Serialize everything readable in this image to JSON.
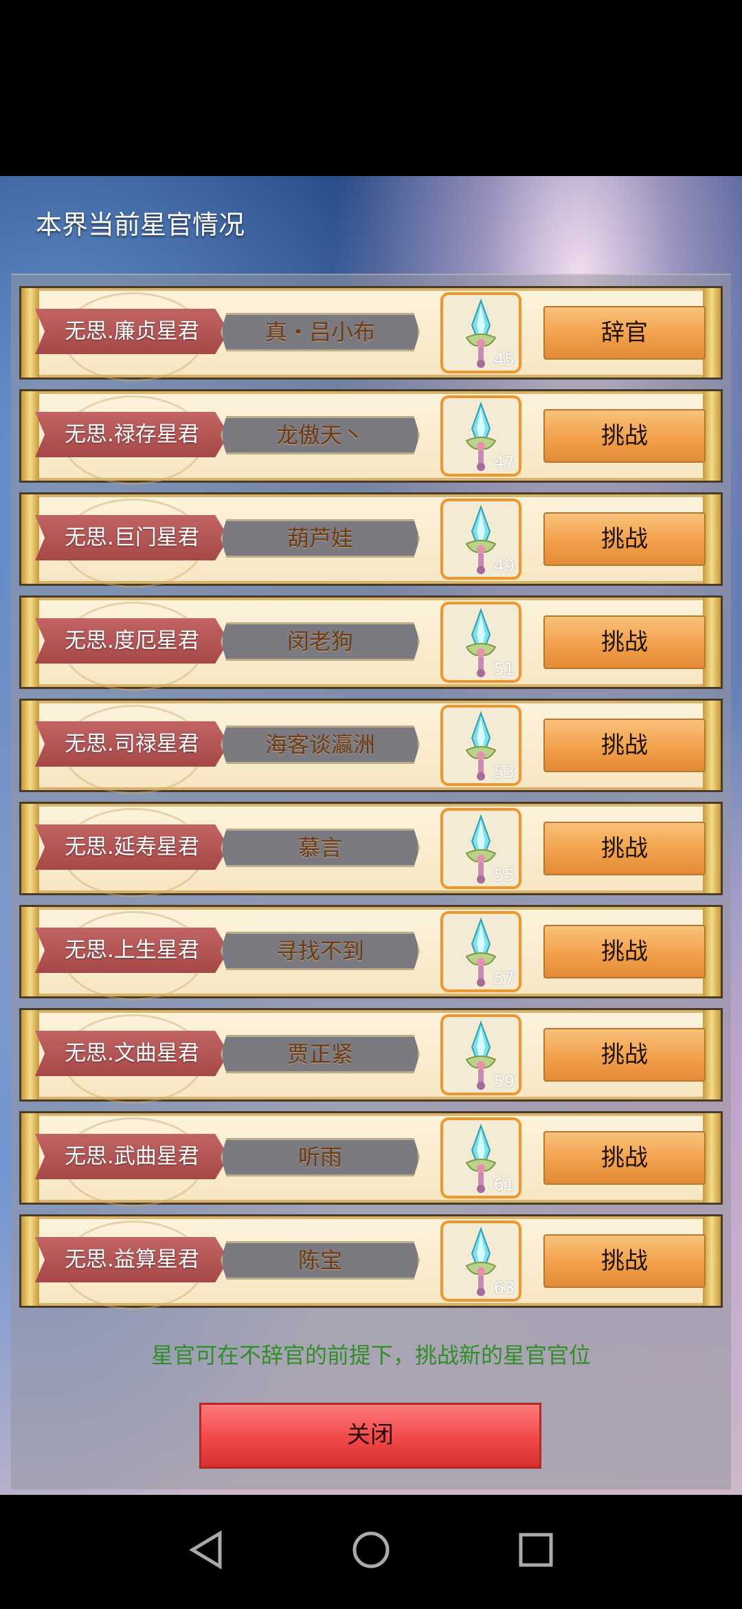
{
  "panel": {
    "title": "本界当前星官情况",
    "rows": [
      {
        "title": "无思.廉贞星君",
        "holder": "真・吕小布",
        "level": "45",
        "action": "辞官"
      },
      {
        "title": "无思.禄存星君",
        "holder": "龙傲天丶",
        "level": "47",
        "action": "挑战"
      },
      {
        "title": "无思.巨门星君",
        "holder": "葫芦娃",
        "level": "49",
        "action": "挑战"
      },
      {
        "title": "无思.度厄星君",
        "holder": "闵老狗",
        "level": "51",
        "action": "挑战"
      },
      {
        "title": "无思.司禄星君",
        "holder": "海客谈瀛洲",
        "level": "53",
        "action": "挑战"
      },
      {
        "title": "无思.延寿星君",
        "holder": "慕言",
        "level": "55",
        "action": "挑战"
      },
      {
        "title": "无思.上生星君",
        "holder": "寻找不到",
        "level": "57",
        "action": "挑战"
      },
      {
        "title": "无思.文曲星君",
        "holder": "贾正紧",
        "level": "59",
        "action": "挑战"
      },
      {
        "title": "无思.武曲星君",
        "holder": "听雨",
        "level": "61",
        "action": "挑战"
      },
      {
        "title": "无思.益算星君",
        "holder": "陈宝",
        "level": "63",
        "action": "挑战"
      }
    ],
    "hint": "星官可在不辞官的前提下，挑战新的星官官位",
    "close_label": "关闭"
  },
  "item_icon": "sword-icon",
  "navbar": {
    "icons": [
      "back-triangle-icon",
      "home-circle-icon",
      "recents-square-icon"
    ]
  },
  "colors": {
    "banner": "#b25555",
    "button": "#f2a04c",
    "hint": "#2f8f26",
    "close": "#f04848"
  }
}
